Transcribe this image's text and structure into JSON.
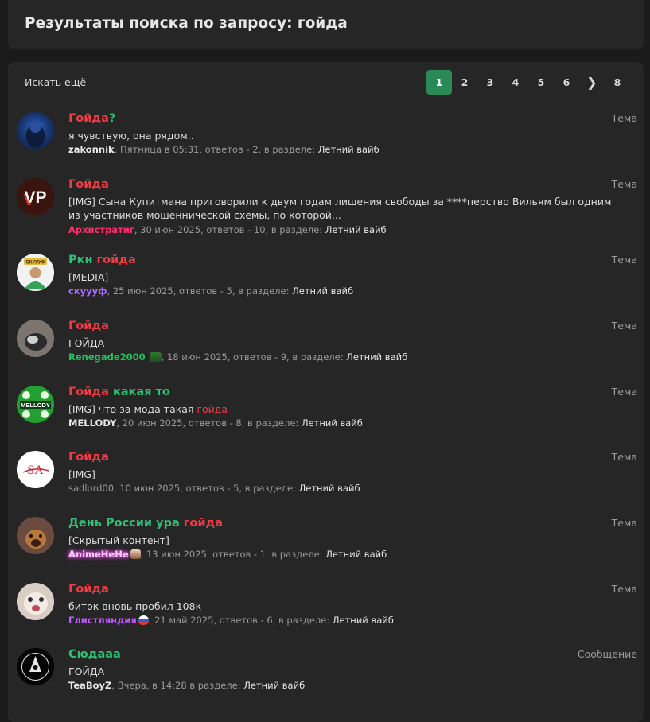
{
  "header": {
    "title": "Результаты поиска по запросу: гойда"
  },
  "toolbar": {
    "search_more": "Искать ещё"
  },
  "pagination": {
    "pages": [
      "1",
      "2",
      "3",
      "4",
      "5",
      "6",
      "8"
    ],
    "active": "1",
    "next_icon": "chevron-right-icon",
    "next_glyph": "❯"
  },
  "results": [
    {
      "title_parts": [
        "Гойда",
        "?"
      ],
      "kind": "Тема",
      "snippet": "я чувствую, она рядом..",
      "user": "zakonnik",
      "meta": ", Пятница в 05:31, ответов - 2, в разделе: ",
      "section": "Летний вайб"
    },
    {
      "title_parts": [
        "Гойда"
      ],
      "kind": "Тема",
      "snippet": "[IMG] Сына Купитмана приговорили к двум годам лишения свободы за ****перство Вильям был одним из участников мошеннической схемы, по которой...",
      "user": "Архистратиг",
      "meta": ", 30 июн 2025, ответов - 10, в разделе: ",
      "section": "Летний вайб",
      "avatar_text": "VP"
    },
    {
      "title_parts": [
        "Ркн ",
        "гойда"
      ],
      "kind": "Тема",
      "snippet": "[MEDIA]",
      "user": "скуууф",
      "meta": ", 25 июн 2025, ответов - 5, в разделе: ",
      "section": "Летний вайб",
      "avatar_text": "СКУУУФ"
    },
    {
      "title_parts": [
        "Гойда"
      ],
      "kind": "Тема",
      "snippet": "ГОЙДА",
      "user": "Renegade2000",
      "meta": ", 18 июн 2025, ответов - 9, в разделе: ",
      "section": "Летний вайб"
    },
    {
      "title_parts": [
        "Гойда",
        " какая то"
      ],
      "kind": "Тема",
      "snippet_parts": [
        "[IMG] что за мода такая ",
        "гойда"
      ],
      "user": "MELLODY",
      "meta": ", 20 июн 2025, ответов - 8, в разделе: ",
      "section": "Летний вайб",
      "avatar_text": "MELLODY"
    },
    {
      "title_parts": [
        "Гойда"
      ],
      "kind": "Тема",
      "snippet": "[IMG]",
      "user": "sadlord00",
      "meta": ", 10 июн 2025, ответов - 5, в разделе: ",
      "section": "Летний вайб",
      "avatar_text": "SA"
    },
    {
      "title_parts": [
        "День России ура ",
        "гойда"
      ],
      "kind": "Тема",
      "snippet": "[Скрытый контент]",
      "user": "AnimeHeHe",
      "meta": ", 13 июн 2025, ответов - 1, в разделе: ",
      "section": "Летний вайб"
    },
    {
      "title_parts": [
        "Гойда"
      ],
      "kind": "Тема",
      "snippet": "биток вновь пробил 108к",
      "user": "Глистляндия",
      "meta": ", 21 май 2025, ответов - 6, в разделе: ",
      "section": "Летний вайб"
    },
    {
      "title_parts": [
        "Сюдааа"
      ],
      "kind": "Сообщение",
      "snippet": "ГОЙДА",
      "user": "TeaBoyZ",
      "meta": ", Вчера, в 14:28 в разделе: ",
      "section": "Летний вайб"
    }
  ]
}
